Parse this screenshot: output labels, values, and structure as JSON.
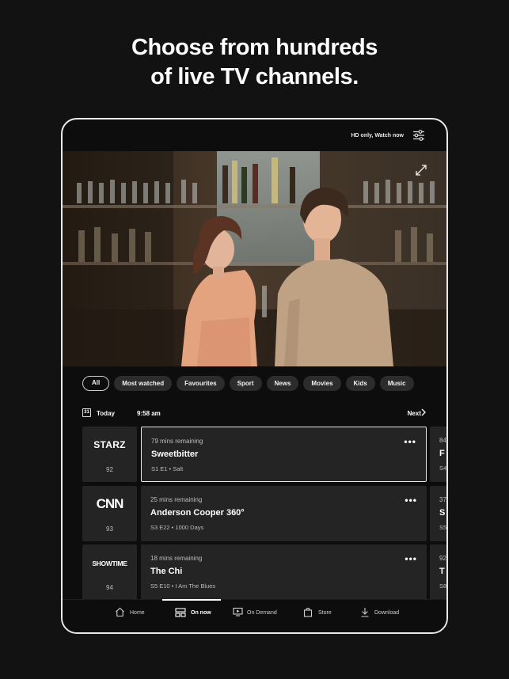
{
  "headline": {
    "line1": "Choose from hundreds",
    "line2": "of live TV channels."
  },
  "topbar": {
    "filter_status": "HD only, Watch now",
    "filter_icon": "sliders-icon"
  },
  "player": {
    "expand_icon": "expand-icon"
  },
  "chips": [
    "All",
    "Most watched",
    "Favourites",
    "Sport",
    "News",
    "Movies",
    "Kids",
    "Music"
  ],
  "chips_active_index": 0,
  "datebar": {
    "calendar_day": "31",
    "day_label": "Today",
    "time": "9:58 am",
    "next_label": "Next"
  },
  "guide": [
    {
      "channel_logo": "STARZ",
      "channel_number": "92",
      "remaining": "79 mins remaining",
      "title": "Sweetbitter",
      "episode": "S1 E1 •  Salt",
      "more": "•••",
      "next_remaining": "84",
      "next_title": "F",
      "next_episode": "S4",
      "selected": true
    },
    {
      "channel_logo": "CNN",
      "channel_number": "93",
      "remaining": "25 mins remaining",
      "title": "Anderson Cooper 360°",
      "episode": "S3 E22 •  1000 Days",
      "more": "•••",
      "next_remaining": "37",
      "next_title": "S",
      "next_episode": "S5",
      "selected": false
    },
    {
      "channel_logo": "SHOWTIME",
      "channel_number": "94",
      "remaining": "18 mins remaining",
      "title": "The Chi",
      "episode": "S5 E10 • I Am The Blues",
      "more": "•••",
      "next_remaining": "92",
      "next_title": "T",
      "next_episode": "S8",
      "selected": false
    }
  ],
  "tabbar": [
    {
      "label": "Home",
      "icon": "home-icon"
    },
    {
      "label": "On now",
      "icon": "tv-guide-icon",
      "active": true
    },
    {
      "label": "On Demand",
      "icon": "on-demand-icon"
    },
    {
      "label": "Store",
      "icon": "bag-icon"
    },
    {
      "label": "Download",
      "icon": "download-icon"
    }
  ]
}
